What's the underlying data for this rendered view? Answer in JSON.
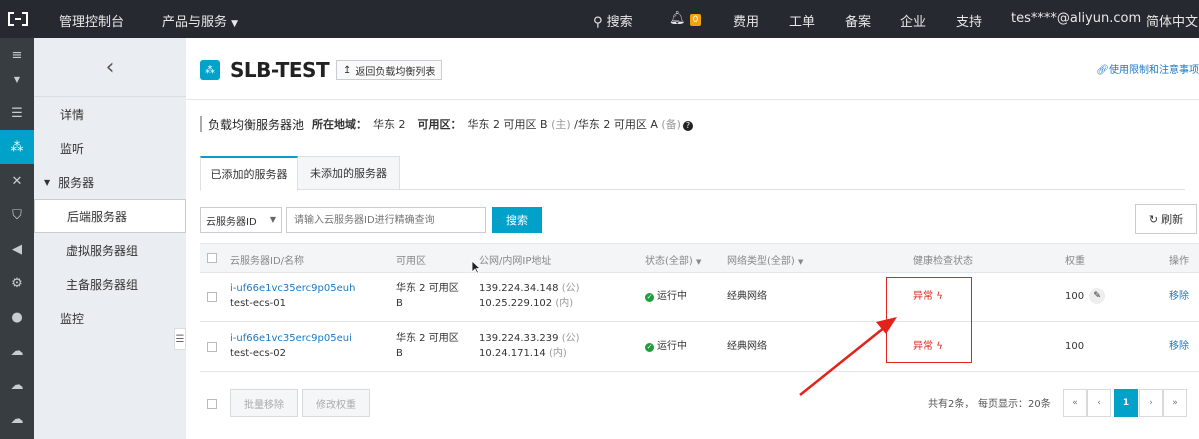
{
  "topbar": {
    "console": "管理控制台",
    "products": "产品与服务",
    "search": "搜索",
    "notice_count": "0",
    "billing": "费用",
    "ticket": "工单",
    "icp": "备案",
    "enterprise": "企业",
    "support": "支持",
    "account": "tes****@aliyun.com",
    "language": "简体中文"
  },
  "subnav": {
    "items": [
      {
        "label": "详情"
      },
      {
        "label": "监听"
      },
      {
        "label": "服务器"
      },
      {
        "label": "后端服务器"
      },
      {
        "label": "虚拟服务器组"
      },
      {
        "label": "主备服务器组"
      },
      {
        "label": "监控"
      }
    ]
  },
  "header": {
    "title": "SLB-TEST",
    "back_label": "返回负载均衡列表",
    "note": "使用限制和注意事项"
  },
  "meta": {
    "section": "负载均衡服务器池",
    "region_key": "所在地域：",
    "region": "华东 2",
    "zone_key": "可用区：",
    "zone_main": "华东 2 可用区 B",
    "zone_main_tag": "(主)",
    "zone_backup": "/华东 2 可用区 A",
    "zone_backup_tag": "(备)"
  },
  "tabs": [
    {
      "label": "已添加的服务器"
    },
    {
      "label": "未添加的服务器"
    }
  ],
  "toolbar": {
    "select_value": "云服务器ID",
    "search_placeholder": "请输入云服务器ID进行精确查询",
    "search_button": "搜索",
    "refresh": "刷新"
  },
  "table": {
    "headers": [
      "云服务器ID/名称",
      "可用区",
      "公网/内网IP地址",
      "状态(全部)",
      "网络类型(全部)",
      "健康检查状态",
      "权重",
      "操作"
    ],
    "rows": [
      {
        "id": "i-uf66e1vc35erc9p05euh",
        "name": "test-ecs-01",
        "zone1": "华东 2 可用区",
        "zone2": "B",
        "ip_public": "139.224.34.148",
        "ip_public_tag": "(公)",
        "ip_private": "10.25.229.102",
        "ip_private_tag": "(内)",
        "status": "运行中",
        "network": "经典网络",
        "health": "异常",
        "weight": "100",
        "action": "移除"
      },
      {
        "id": "i-uf66e1vc35erc9p05eui",
        "name": "test-ecs-02",
        "zone1": "华东 2 可用区",
        "zone2": "B",
        "ip_public": "139.224.33.239",
        "ip_public_tag": "(公)",
        "ip_private": "10.24.171.14",
        "ip_private_tag": "(内)",
        "status": "运行中",
        "network": "经典网络",
        "health": "异常",
        "weight": "100",
        "action": "移除"
      }
    ]
  },
  "footer": {
    "batch_remove": "批量移除",
    "edit_weight": "修改权重",
    "total": "共有2条，",
    "page_size": "每页显示：20条",
    "current_page": "1"
  },
  "colors": {
    "accent": "#00a2ca",
    "topbar": "#262a30",
    "error": "#e2231a",
    "running": "#1e9e3a",
    "link": "#1e78c2"
  }
}
